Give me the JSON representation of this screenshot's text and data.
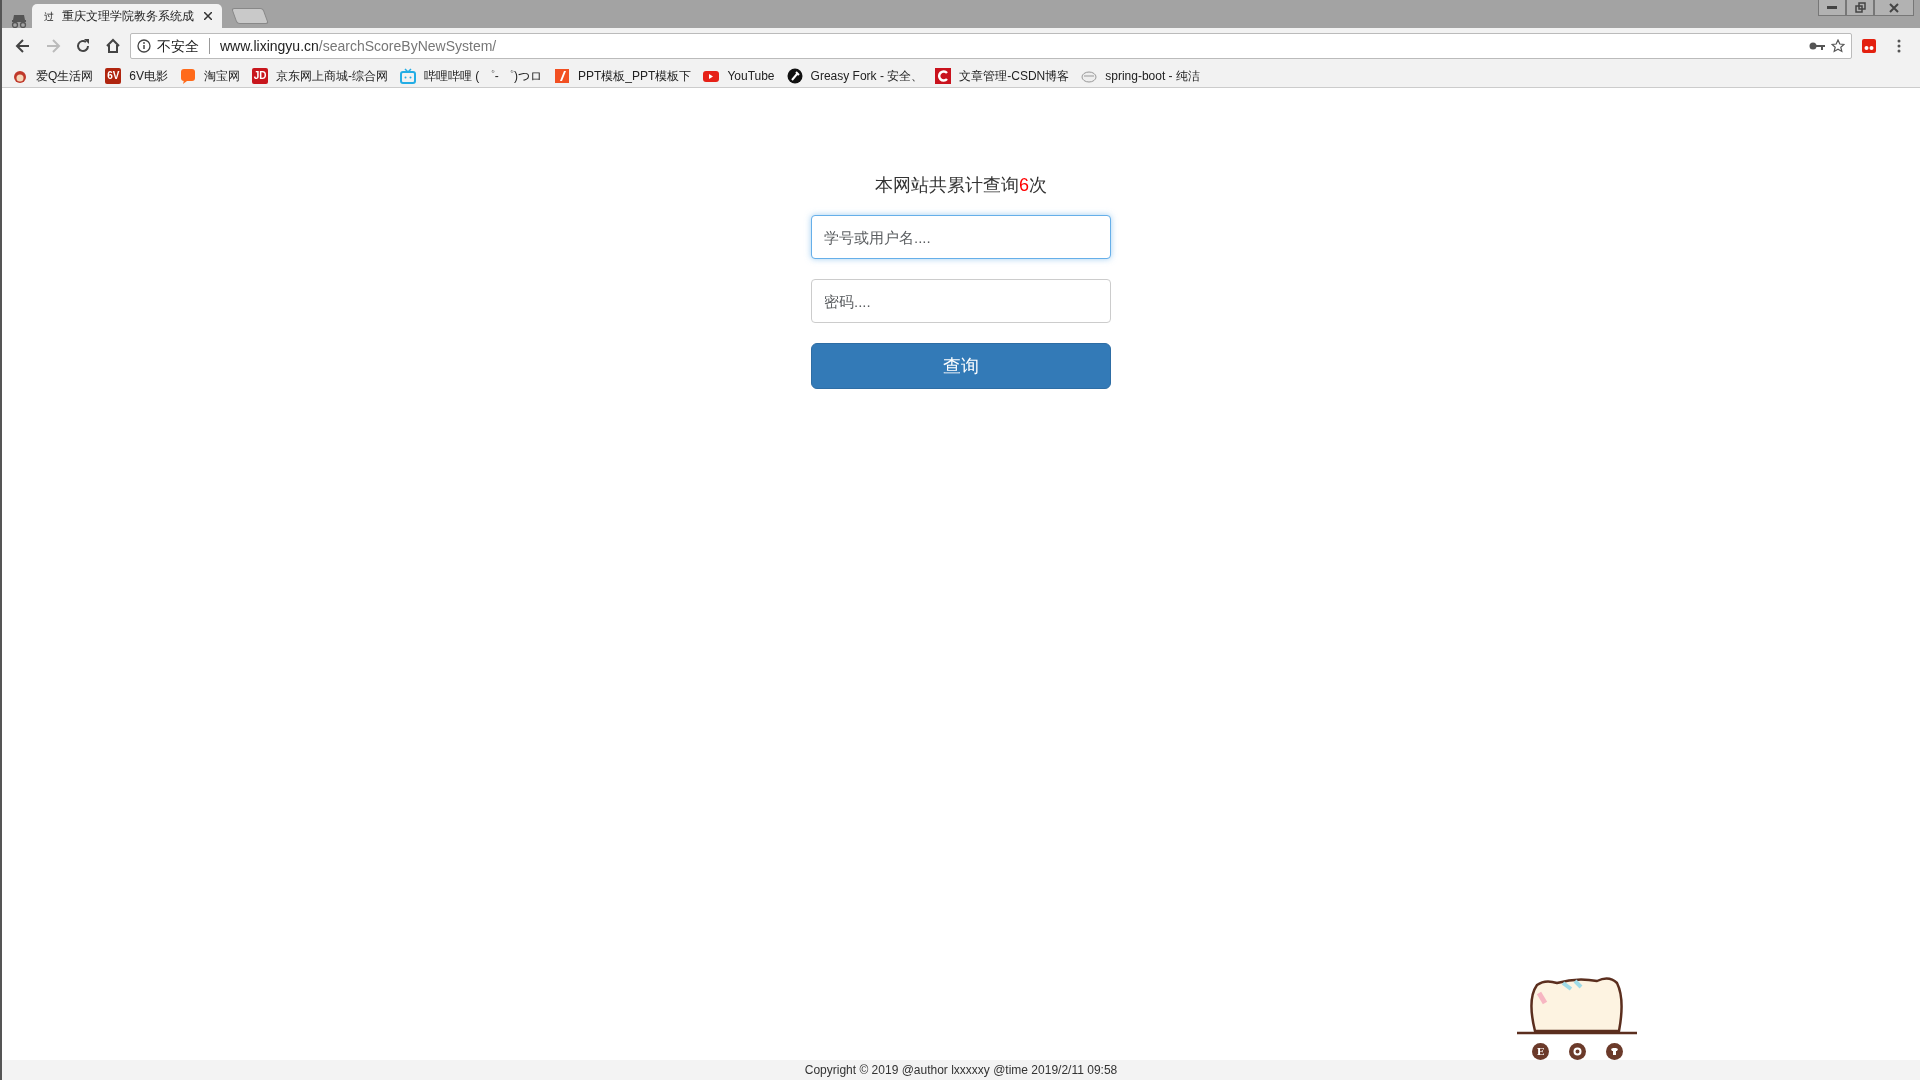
{
  "browser": {
    "tab": {
      "favicon": "过",
      "title": "重庆文理学院教务系统成",
      "selected": true
    },
    "address": {
      "security": "不安全",
      "host": "www.lixingyu.cn",
      "path": "/searchScoreByNewSystem/"
    },
    "bookmarks": [
      {
        "label": "爱Q生活网"
      },
      {
        "badge": "6V",
        "label": "6V电影"
      },
      {
        "label": "淘宝网"
      },
      {
        "badge": "JD",
        "label": "京东网上商城-综合网"
      },
      {
        "label": "哔哩哔哩 ( ゜- ゜)つロ"
      },
      {
        "label": "PPT模板_PPT模板下"
      },
      {
        "label": "YouTube"
      },
      {
        "label": "Greasy Fork - 安全、"
      },
      {
        "label": "文章管理-CSDN博客"
      },
      {
        "label": "spring-boot - 纯洁"
      }
    ]
  },
  "page": {
    "counter": {
      "prefix": "本网站共累计查询",
      "count": "6",
      "suffix": "次"
    },
    "fields": [
      {
        "placeholder": "学号或用户名....",
        "focused": true
      },
      {
        "placeholder": "密码....",
        "focused": false
      }
    ],
    "submit": "查询",
    "mascot_letter": "E",
    "footer": "Copyright © 2019 @author lxxxxxy @time 2019/2/11 09:58"
  }
}
